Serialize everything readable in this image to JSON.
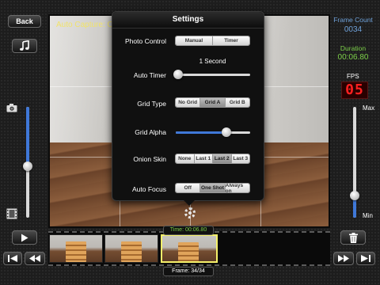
{
  "left_panel": {
    "back_label": "Back",
    "music_icon": "music-note-icon",
    "camera_icon": "camera-icon",
    "film_icon": "film-icon",
    "play_icon": "play-icon",
    "speed_level": 0.55
  },
  "viewport": {
    "caption": "Auto Capture: On"
  },
  "settings": {
    "title": "Settings",
    "photo_control": {
      "label": "Photo Control",
      "options": [
        "Manual",
        "Timer"
      ],
      "selected": 0
    },
    "auto_timer": {
      "label": "Auto Timer",
      "value_text": "1 Second",
      "level": 0.05
    },
    "grid_type": {
      "label": "Grid Type",
      "options": [
        "No Grid",
        "Grid A",
        "Grid B"
      ],
      "selected": 1
    },
    "grid_alpha": {
      "label": "Grid Alpha",
      "level": 0.68
    },
    "onion_skin": {
      "label": "Onion Skin",
      "options": [
        "None",
        "Last 1",
        "Last 2",
        "Last 3"
      ],
      "selected": 2
    },
    "auto_focus": {
      "label": "Auto Focus",
      "options": [
        "Off",
        "One Shot",
        "Always on"
      ],
      "selected": 1
    },
    "gear_icon": "gear-icon"
  },
  "right_panel": {
    "frame_count_label": "Frame Count",
    "frame_count_value": "0034",
    "duration_label": "Duration",
    "duration_value": "00:06.80",
    "fps_label": "FPS",
    "fps_value": "05",
    "max_label": "Max",
    "min_label": "Min",
    "fps_level": 0.22
  },
  "filmstrip": {
    "time_tag": "Time:  00:06.80",
    "frame_tag": "Frame: 34/34",
    "frames": [
      "frame-32",
      "frame-33",
      "frame-34"
    ],
    "current_index": 2
  },
  "bottom_controls": {
    "first_icon": "skip-to-start-icon",
    "rewind_icon": "rewind-icon",
    "forward_icon": "fast-forward-icon",
    "last_icon": "skip-to-end-icon",
    "delete_icon": "trash-icon"
  },
  "colors": {
    "accent_blue": "#3f78d8",
    "info_blue": "#6ea0d8",
    "info_green": "#7ccf49",
    "fps_red": "#ff2020",
    "caption_yellow": "#f1e36a"
  }
}
